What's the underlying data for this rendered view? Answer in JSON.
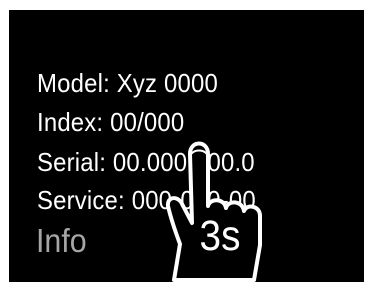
{
  "device_screen": {
    "info_lines": {
      "model": "Model: Xyz 0000",
      "index": "Index: 00/000",
      "serial": "Serial: 00.000.000.0",
      "service": "Service: 000-000-00"
    },
    "title": "Info"
  },
  "gesture": {
    "icon": "hand-press-icon",
    "duration_label": "3s"
  },
  "colors": {
    "screen_background": "#000000",
    "text": "#ffffff",
    "title_text": "#a6a6a6"
  }
}
